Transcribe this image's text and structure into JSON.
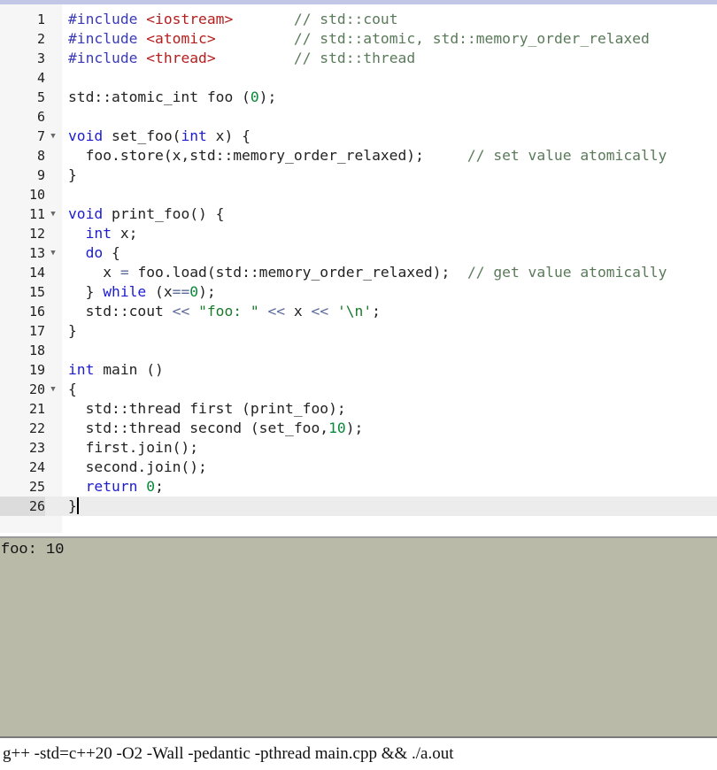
{
  "editor": {
    "active_line": 26,
    "lines": [
      {
        "n": "1",
        "fold": false,
        "tokens": [
          {
            "c": "pp",
            "t": "#include "
          },
          {
            "c": "inc",
            "t": "<iostream>"
          },
          {
            "c": "",
            "t": "       "
          },
          {
            "c": "cm",
            "t": "// std::cout"
          }
        ]
      },
      {
        "n": "2",
        "fold": false,
        "tokens": [
          {
            "c": "pp",
            "t": "#include "
          },
          {
            "c": "inc",
            "t": "<atomic>"
          },
          {
            "c": "",
            "t": "         "
          },
          {
            "c": "cm",
            "t": "// std::atomic, std::memory_order_relaxed"
          }
        ]
      },
      {
        "n": "3",
        "fold": false,
        "tokens": [
          {
            "c": "pp",
            "t": "#include "
          },
          {
            "c": "inc",
            "t": "<thread>"
          },
          {
            "c": "",
            "t": "         "
          },
          {
            "c": "cm",
            "t": "// std::thread"
          }
        ]
      },
      {
        "n": "4",
        "fold": false,
        "tokens": []
      },
      {
        "n": "5",
        "fold": false,
        "tokens": [
          {
            "c": "",
            "t": "std::atomic_int foo ("
          },
          {
            "c": "num",
            "t": "0"
          },
          {
            "c": "",
            "t": ");"
          }
        ]
      },
      {
        "n": "6",
        "fold": false,
        "tokens": []
      },
      {
        "n": "7",
        "fold": true,
        "tokens": [
          {
            "c": "kw",
            "t": "void"
          },
          {
            "c": "",
            "t": " set_foo("
          },
          {
            "c": "kw",
            "t": "int"
          },
          {
            "c": "",
            "t": " x) {"
          }
        ]
      },
      {
        "n": "8",
        "fold": false,
        "tokens": [
          {
            "c": "",
            "t": "  foo.store(x,std::memory_order_relaxed);     "
          },
          {
            "c": "cm",
            "t": "// set value atomically"
          }
        ]
      },
      {
        "n": "9",
        "fold": false,
        "tokens": [
          {
            "c": "",
            "t": "}"
          }
        ]
      },
      {
        "n": "10",
        "fold": false,
        "tokens": []
      },
      {
        "n": "11",
        "fold": true,
        "tokens": [
          {
            "c": "kw",
            "t": "void"
          },
          {
            "c": "",
            "t": " print_foo() {"
          }
        ]
      },
      {
        "n": "12",
        "fold": false,
        "tokens": [
          {
            "c": "",
            "t": "  "
          },
          {
            "c": "kw",
            "t": "int"
          },
          {
            "c": "",
            "t": " x;"
          }
        ]
      },
      {
        "n": "13",
        "fold": true,
        "tokens": [
          {
            "c": "",
            "t": "  "
          },
          {
            "c": "kw",
            "t": "do"
          },
          {
            "c": "",
            "t": " {"
          }
        ]
      },
      {
        "n": "14",
        "fold": false,
        "tokens": [
          {
            "c": "",
            "t": "    x "
          },
          {
            "c": "op",
            "t": "="
          },
          {
            "c": "",
            "t": " foo.load(std::memory_order_relaxed);  "
          },
          {
            "c": "cm",
            "t": "// get value atomically"
          }
        ]
      },
      {
        "n": "15",
        "fold": false,
        "tokens": [
          {
            "c": "",
            "t": "  } "
          },
          {
            "c": "kw",
            "t": "while"
          },
          {
            "c": "",
            "t": " (x"
          },
          {
            "c": "op",
            "t": "=="
          },
          {
            "c": "num",
            "t": "0"
          },
          {
            "c": "",
            "t": ");"
          }
        ]
      },
      {
        "n": "16",
        "fold": false,
        "tokens": [
          {
            "c": "",
            "t": "  std::cout "
          },
          {
            "c": "op",
            "t": "<<"
          },
          {
            "c": "",
            "t": " "
          },
          {
            "c": "str",
            "t": "\"foo: \""
          },
          {
            "c": "",
            "t": " "
          },
          {
            "c": "op",
            "t": "<<"
          },
          {
            "c": "",
            "t": " x "
          },
          {
            "c": "op",
            "t": "<<"
          },
          {
            "c": "",
            "t": " "
          },
          {
            "c": "str",
            "t": "'\\n'"
          },
          {
            "c": "",
            "t": ";"
          }
        ]
      },
      {
        "n": "17",
        "fold": false,
        "tokens": [
          {
            "c": "",
            "t": "}"
          }
        ]
      },
      {
        "n": "18",
        "fold": false,
        "tokens": []
      },
      {
        "n": "19",
        "fold": false,
        "tokens": [
          {
            "c": "kw",
            "t": "int"
          },
          {
            "c": "",
            "t": " main ()"
          }
        ]
      },
      {
        "n": "20",
        "fold": true,
        "tokens": [
          {
            "c": "",
            "t": "{"
          }
        ]
      },
      {
        "n": "21",
        "fold": false,
        "tokens": [
          {
            "c": "",
            "t": "  std::thread first (print_foo);"
          }
        ]
      },
      {
        "n": "22",
        "fold": false,
        "tokens": [
          {
            "c": "",
            "t": "  std::thread second (set_foo,"
          },
          {
            "c": "num",
            "t": "10"
          },
          {
            "c": "",
            "t": ");"
          }
        ]
      },
      {
        "n": "23",
        "fold": false,
        "tokens": [
          {
            "c": "",
            "t": "  first.join();"
          }
        ]
      },
      {
        "n": "24",
        "fold": false,
        "tokens": [
          {
            "c": "",
            "t": "  second.join();"
          }
        ]
      },
      {
        "n": "25",
        "fold": false,
        "tokens": [
          {
            "c": "",
            "t": "  "
          },
          {
            "c": "kw",
            "t": "return"
          },
          {
            "c": "",
            "t": " "
          },
          {
            "c": "num",
            "t": "0"
          },
          {
            "c": "",
            "t": ";"
          }
        ]
      },
      {
        "n": "26",
        "fold": false,
        "tokens": [
          {
            "c": "",
            "t": "}"
          }
        ]
      }
    ]
  },
  "output": {
    "text": "foo: 10"
  },
  "command": {
    "value": "g++ -std=c++20 -O2 -Wall -pedantic -pthread main.cpp && ./a.out"
  },
  "colors": {
    "output_bg": "#b9baa8",
    "keyword": "#1c1cd0",
    "include_path": "#b41e1e",
    "comment": "#5a7a5a",
    "number": "#0a8a3a"
  },
  "icons": {
    "fold": "fold-arrow-icon"
  }
}
